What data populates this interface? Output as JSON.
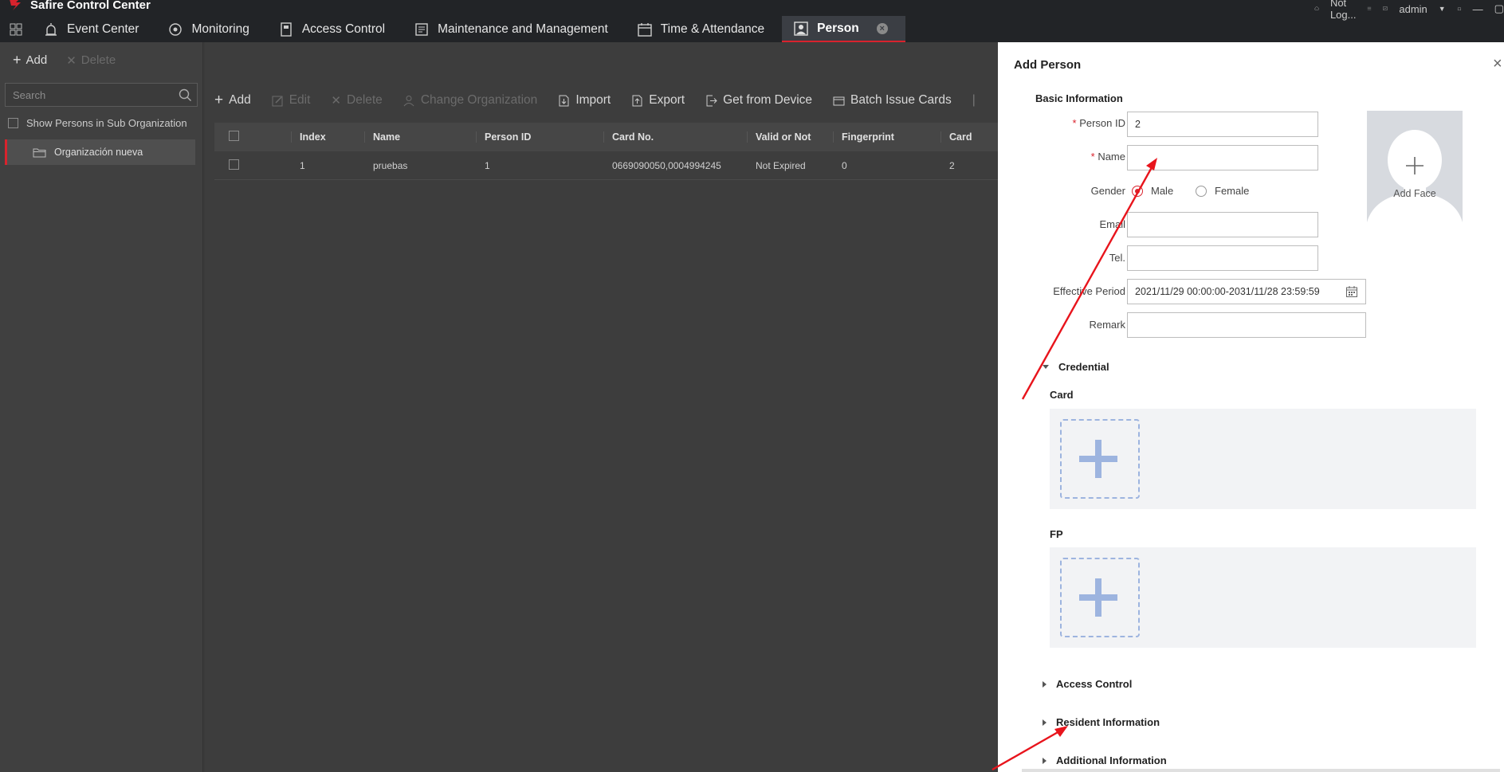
{
  "app": {
    "title": "Safire Control Center",
    "status": "Not Log...",
    "user": "admin"
  },
  "tabs": [
    {
      "label": "Event Center",
      "icon": "event-center-icon"
    },
    {
      "label": "Monitoring",
      "icon": "monitoring-icon"
    },
    {
      "label": "Access Control",
      "icon": "access-control-icon"
    },
    {
      "label": "Maintenance and Management",
      "icon": "maintenance-icon"
    },
    {
      "label": "Time & Attendance",
      "icon": "calendar-icon"
    },
    {
      "label": "Person",
      "icon": "person-icon",
      "active": true
    }
  ],
  "left_panel": {
    "add_label": "Add",
    "delete_label": "Delete",
    "search_placeholder": "Search",
    "sub_org_label": "Show Persons in Sub Organization",
    "org_name": "Organización nueva"
  },
  "toolbar": {
    "add": "Add",
    "edit": "Edit",
    "delete": "Delete",
    "change_org": "Change Organization",
    "import": "Import",
    "export": "Export",
    "get_from_device": "Get from Device",
    "batch_issue": "Batch Issue Cards"
  },
  "table": {
    "headers": [
      "Index",
      "Name",
      "Person ID",
      "Card No.",
      "Valid or Not",
      "Fingerprint",
      "Card"
    ],
    "rows": [
      [
        "1",
        "pruebas",
        "1",
        "0669090050,0004994245",
        "Not Expired",
        "0",
        "2"
      ]
    ]
  },
  "drawer": {
    "title": "Add Person",
    "basic_info_title": "Basic Information",
    "labels": {
      "person_id": "Person ID",
      "name": "Name",
      "gender": "Gender",
      "email": "Email",
      "tel": "Tel.",
      "effective_period": "Effective Period",
      "remark": "Remark"
    },
    "values": {
      "person_id": "2",
      "name": "",
      "email": "",
      "tel": "",
      "effective_period": "2021/11/29 00:00:00-2031/11/28 23:59:59",
      "remark": ""
    },
    "gender_options": {
      "male": "Male",
      "female": "Female",
      "selected": "Male"
    },
    "add_face": "Add Face",
    "credential_title": "Credential",
    "card_label": "Card",
    "fp_label": "FP",
    "sections": [
      "Access Control",
      "Resident Information",
      "Additional Information"
    ]
  },
  "colors": {
    "accent": "#d9232d",
    "annotation_arrow": "#e8141c",
    "tile_plus": "#9db4df"
  }
}
